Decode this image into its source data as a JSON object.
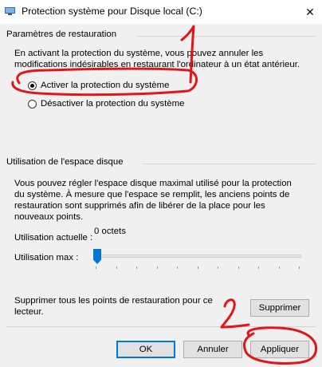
{
  "window": {
    "title": "Protection système pour Disque local (C:)",
    "close_glyph": "✕"
  },
  "restore_settings": {
    "header": "Paramètres de restauration",
    "description": "En activant la protection du système, vous pouvez annuler les modifications indésirables en restaurant l'ordinateur à un état antérieur.",
    "options": [
      {
        "label": "Activer la protection du système",
        "checked": true
      },
      {
        "label": "Désactiver la protection du système",
        "checked": false
      }
    ]
  },
  "disk_usage": {
    "header": "Utilisation de l'espace disque",
    "description": "Vous pouvez régler l'espace disque maximal utilisé pour la protection du système. À mesure que l'espace se remplit, les anciens points de restauration sont supprimés afin de libérer de la place pour les nouveaux points.",
    "current_usage_label": "Utilisation actuelle :",
    "current_usage_value": "0 octets",
    "max_usage_label": "Utilisation max :",
    "max_usage_level": 0
  },
  "delete_section": {
    "text": "Supprimer tous les points de restauration pour ce lecteur.",
    "button_label": "Supprimer"
  },
  "footer": {
    "ok_label": "OK",
    "cancel_label": "Annuler",
    "apply_label": "Appliquer"
  },
  "annotations": {
    "color": "#e11616",
    "marker_1": "1",
    "marker_2": "2"
  },
  "colors": {
    "accent": "#0078d7",
    "background": "#f0f0f0"
  }
}
